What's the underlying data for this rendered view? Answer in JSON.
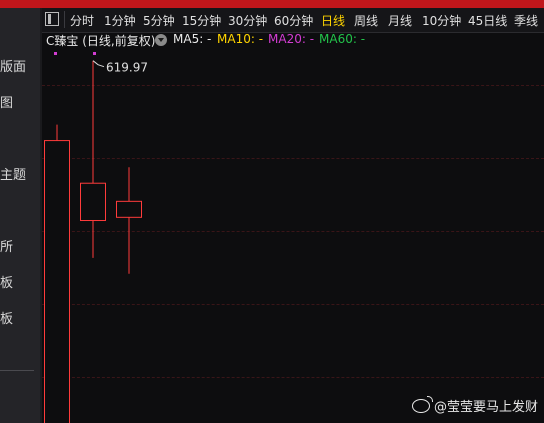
{
  "sidebar": {
    "items": [
      {
        "label": "版面"
      },
      {
        "label": "图"
      },
      {
        "label": "主题"
      },
      {
        "label": "所"
      },
      {
        "label": "板"
      },
      {
        "label": "板"
      }
    ]
  },
  "periods": [
    "分时",
    "1分钟",
    "5分钟",
    "15分钟",
    "30分钟",
    "60分钟",
    "日线",
    "周线",
    "月线",
    "10分钟",
    "45日线",
    "季线"
  ],
  "active_period": "日线",
  "info": {
    "stock": "C臻宝 (日线,前复权)",
    "ma5_label": "MA5: -",
    "ma10_label": "MA10: -",
    "ma20_label": "MA20: -",
    "ma60_label": "MA60: -"
  },
  "colors": {
    "ma5": "#e8e8e8",
    "ma10": "#ffd400",
    "ma20": "#d23cd2",
    "ma60": "#22c24a",
    "candle_up": "#ff3b3b",
    "accent_red": "#c0161b"
  },
  "high_label": "619.97",
  "watermark": "@莹莹要马上发财",
  "chart_data": {
    "type": "candlestick",
    "candles": [
      {
        "open": 270,
        "close": 545,
        "high": 560,
        "low": 255
      },
      {
        "open": 470,
        "close": 505,
        "high": 619.97,
        "low": 435
      },
      {
        "open": 473,
        "close": 488,
        "high": 520,
        "low": 420
      }
    ],
    "ylim": [
      280,
      630
    ],
    "grid": true
  }
}
